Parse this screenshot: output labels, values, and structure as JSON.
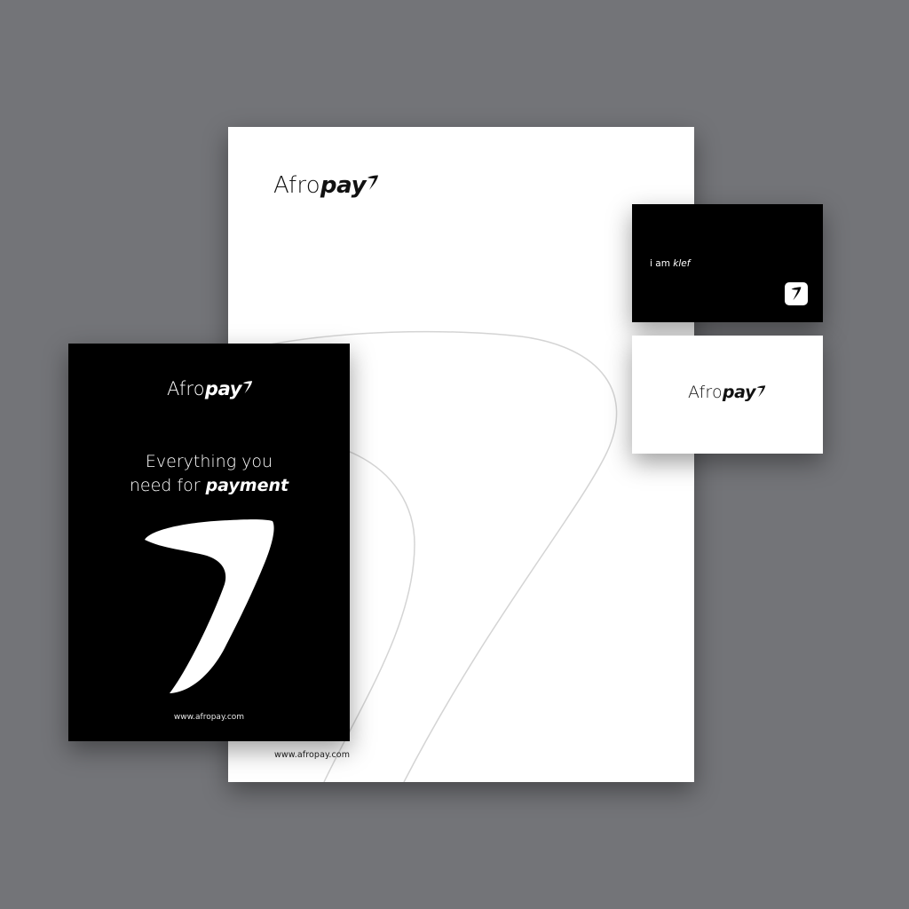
{
  "brand": {
    "name_regular": "Afro",
    "name_bold": "pay",
    "mark_icon": "boomerang-7-icon",
    "colors": {
      "background": "#737478",
      "black": "#000000",
      "white": "#ffffff",
      "line": "#d4d4d4"
    }
  },
  "letterhead": {
    "url": "www.afropay.com"
  },
  "poster": {
    "tagline_line1": "Everything you",
    "tagline_line2_prefix": "need for ",
    "tagline_line2_emphasis": "payment",
    "url": "www.afropay.com"
  },
  "business_card_front": {
    "text_prefix": "i am ",
    "text_emphasis": "klef",
    "icon": "boomerang-7-icon"
  },
  "business_card_back": {}
}
